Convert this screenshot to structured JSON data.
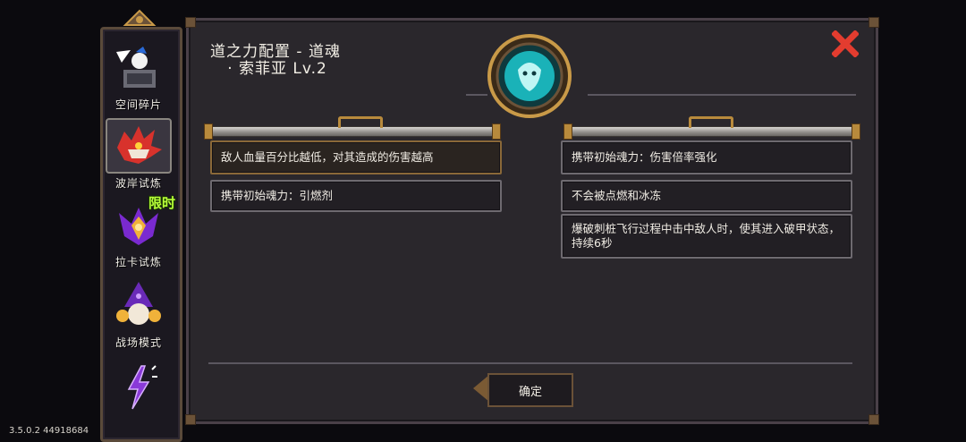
{
  "sidebar": {
    "items": [
      {
        "label": "空间碎片",
        "icon": "shrine-icon"
      },
      {
        "label": "波岸试炼",
        "icon": "red-dragon-icon"
      },
      {
        "label": "拉卡试炼",
        "icon": "purple-crest-icon",
        "badge": "限时"
      },
      {
        "label": "战场模式",
        "icon": "wizard-icon"
      },
      {
        "label": "",
        "icon": "lightning-icon"
      }
    ]
  },
  "panel": {
    "title": "道之力配置 - 道魂\n   · 索菲亚 Lv.2",
    "left_effects": [
      "敌人血量百分比越低，对其造成的伤害越高",
      "携带初始魂力：引燃剂"
    ],
    "right_effects": [
      "携带初始魂力：伤害倍率强化",
      "不会被点燃和冰冻",
      "爆破刺桩飞行过程中击中敌人时，使其进入破甲状态，持续6秒"
    ],
    "confirm_label": "确定"
  },
  "version": "3.5.0.2 44918684",
  "colors": {
    "accent": "#b88a3c",
    "close": "#e33c2f",
    "limited": "#b8ff3a",
    "medal": "#2bd4d8"
  }
}
